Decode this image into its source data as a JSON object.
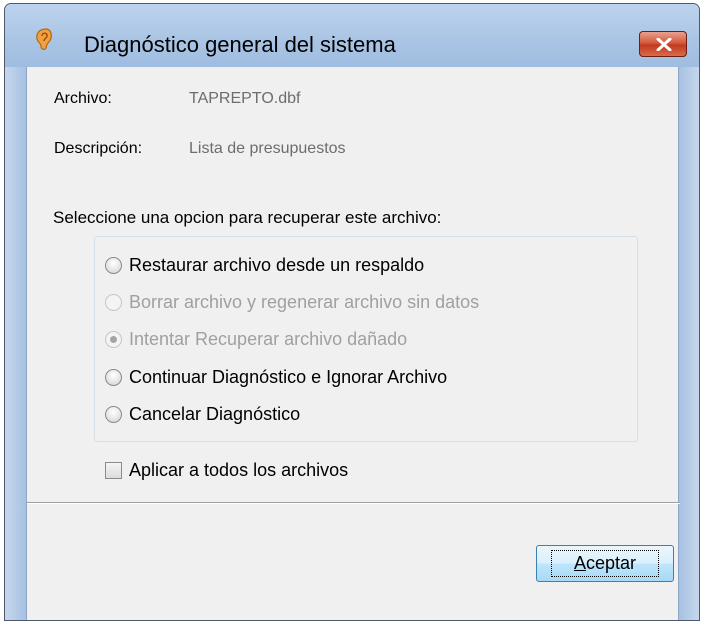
{
  "window": {
    "title": "Diagnóstico general del sistema",
    "icon": "ear-icon",
    "close_icon": "close-icon",
    "close_color": "#c9452a"
  },
  "fields": {
    "file_label": "Archivo:",
    "file_value": "TAPREPTO.dbf",
    "description_label": "Descripción:",
    "description_value": "Lista de presupuestos"
  },
  "options": {
    "prompt": "Seleccione una opcion para recuperar este archivo:",
    "items": [
      {
        "label": "Restaurar archivo desde un respaldo",
        "enabled": true,
        "checked": false
      },
      {
        "label": "Borrar archivo y regenerar archivo sin datos",
        "enabled": false,
        "checked": false
      },
      {
        "label": "Intentar Recuperar archivo dañado",
        "enabled": false,
        "checked": true
      },
      {
        "label": "Continuar Diagnóstico e Ignorar Archivo",
        "enabled": true,
        "checked": false
      },
      {
        "label": "Cancelar Diagnóstico",
        "enabled": true,
        "checked": false
      }
    ]
  },
  "apply_all": {
    "label": "Aplicar a todos los archivos",
    "checked": false
  },
  "buttons": {
    "accept_mnemonic": "A",
    "accept_rest": "ceptar"
  }
}
